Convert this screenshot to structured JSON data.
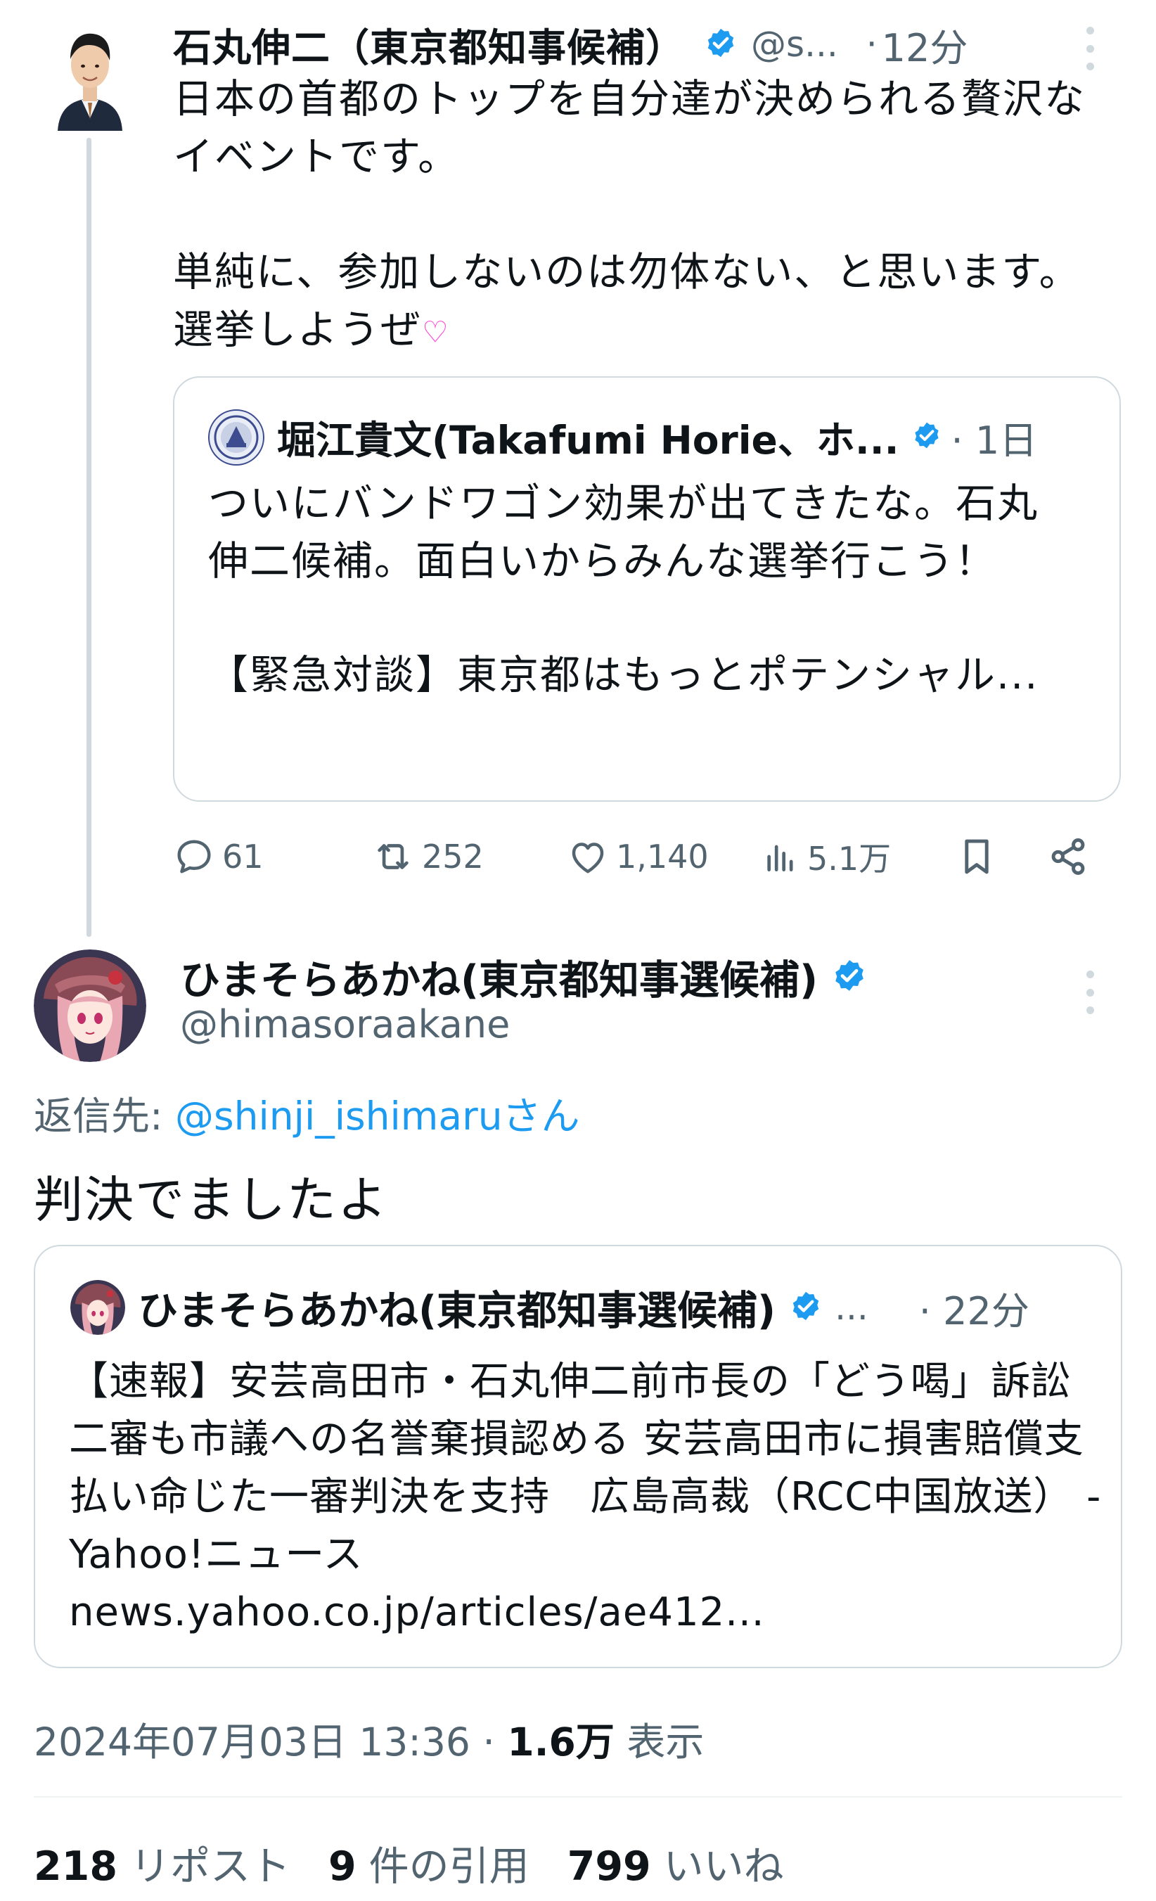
{
  "parent_tweet": {
    "author_name": "石丸伸二（東京都知事候補）",
    "handle": "@s...",
    "separator": "·",
    "time": "12分",
    "paragraphs": [
      "日本の首都のトップを自分達が決められる贅沢なイベントです。",
      "単純に、参加しないのは勿体ない、と思います。選挙しようぜ"
    ],
    "emoji": "♡",
    "quoted": {
      "author_name": "堀江貴文(Takafumi Horie、ホ...",
      "time": "· 1日",
      "paragraphs": [
        "ついにバンドワゴン効果が出てきたな。石丸伸二候補。面白いからみんな選挙行こう！",
        "【緊急対談】東京都はもっとポテンシャル..."
      ]
    },
    "actions": {
      "replies": "61",
      "reposts": "252",
      "likes": "1,140",
      "views": "5.1万"
    }
  },
  "reply_tweet": {
    "author_name": "ひまそらあかね(東京都知事選候補)",
    "handle": "@himasoraakane",
    "reply_to_label": "返信先:",
    "reply_to_mention": "@shinji_ishimaruさん",
    "text": "判決でましたよ",
    "quoted": {
      "author_name": "ひまそらあかね(東京都知事選候補)",
      "ellipsis": "...",
      "time": "· 22分",
      "text": "【速報】安芸高田市・石丸伸二前市長の「どう喝」訴訟　二審も市議への名誉棄損認める 安芸高田市に損害賠償支払い命じた一審判決を支持　広島高裁（RCC中国放送） - Yahoo!ニュース",
      "link": "news.yahoo.co.jp/articles/ae412..."
    },
    "timestamp": "2024年07月03日 13:36 ·",
    "view_count": "1.6万",
    "view_label": "表示",
    "stats": {
      "reposts_count": "218",
      "reposts_label": "リポスト",
      "quotes_count": "9",
      "quotes_label": "件の引用",
      "likes_count": "799",
      "likes_label": "いいね"
    }
  },
  "colors": {
    "verified": "#1d9bf0",
    "secondary_text": "#536471",
    "border": "#cfd9de",
    "link": "#1d9bf0"
  }
}
